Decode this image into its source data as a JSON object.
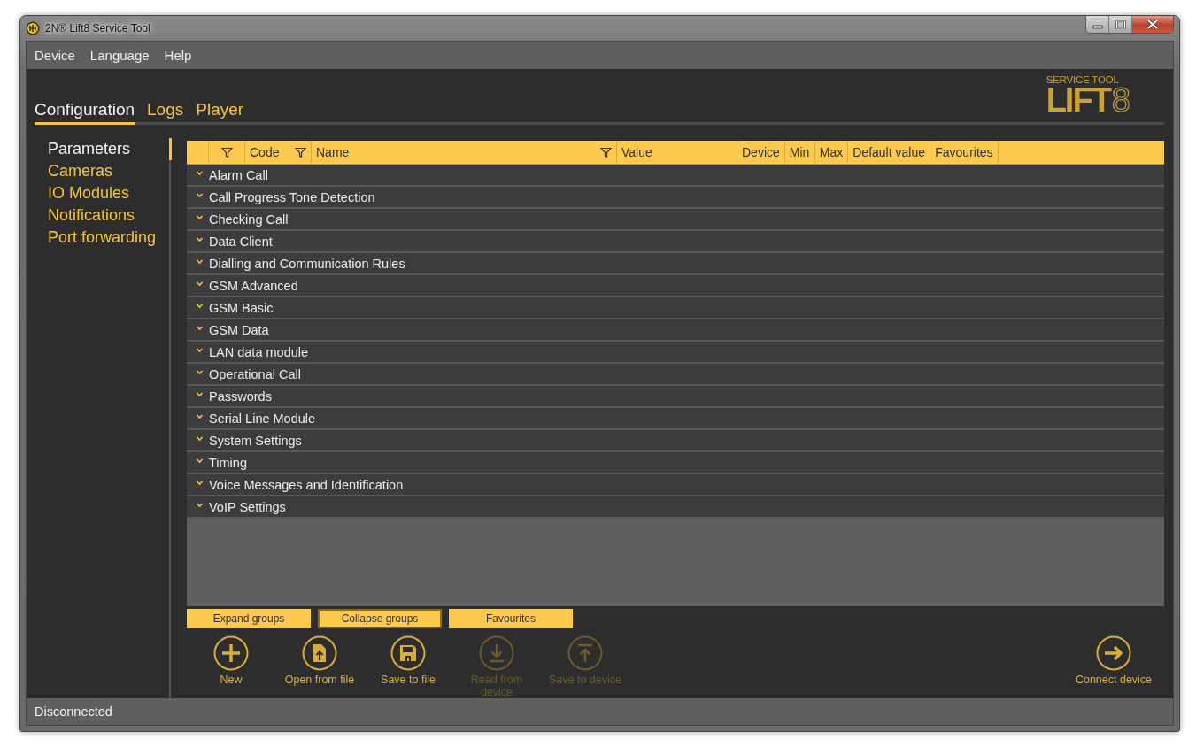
{
  "window": {
    "title": "2N® Lift8 Service Tool"
  },
  "menu": [
    "Device",
    "Language",
    "Help"
  ],
  "tabs": [
    {
      "label": "Configuration",
      "selected": true
    },
    {
      "label": "Logs",
      "selected": false
    },
    {
      "label": "Player",
      "selected": false
    }
  ],
  "logo": {
    "tagline": "SERVICE TOOL",
    "wordmark": "LIFT",
    "numeral": "8"
  },
  "sidebar": {
    "items": [
      {
        "label": "Parameters",
        "selected": true
      },
      {
        "label": "Cameras",
        "selected": false
      },
      {
        "label": "IO Modules",
        "selected": false
      },
      {
        "label": "Notifications",
        "selected": false
      },
      {
        "label": "Port forwarding",
        "selected": false
      }
    ]
  },
  "table": {
    "columns": [
      {
        "filter": false
      },
      {
        "filter": true
      },
      {
        "label": "Code",
        "filter": true
      },
      {
        "label": "Name",
        "filter": true
      },
      {
        "label": "Value",
        "filter": false
      },
      {
        "label": "Device",
        "filter": false
      },
      {
        "label": "Min",
        "filter": false
      },
      {
        "label": "Max",
        "filter": false
      },
      {
        "label": "Default value",
        "filter": false
      },
      {
        "label": "Favourites",
        "filter": false
      }
    ],
    "groups": [
      {
        "name": "Alarm Call",
        "expanded": false
      },
      {
        "name": "Call Progress Tone Detection",
        "expanded": false
      },
      {
        "name": "Checking Call",
        "expanded": false
      },
      {
        "name": "Data Client",
        "expanded": false
      },
      {
        "name": "Dialling and Communication Rules",
        "expanded": false
      },
      {
        "name": "GSM Advanced",
        "expanded": false
      },
      {
        "name": "GSM Basic",
        "expanded": false
      },
      {
        "name": "GSM Data",
        "expanded": false
      },
      {
        "name": "LAN data module",
        "expanded": false
      },
      {
        "name": "Operational Call",
        "expanded": false
      },
      {
        "name": "Passwords",
        "expanded": false
      },
      {
        "name": "Serial Line Module",
        "expanded": false
      },
      {
        "name": "System Settings",
        "expanded": false
      },
      {
        "name": "Timing",
        "expanded": false
      },
      {
        "name": "Voice Messages and Identification",
        "expanded": false
      },
      {
        "name": "VoIP Settings",
        "expanded": false
      }
    ]
  },
  "group_buttons": [
    {
      "label": "Expand groups",
      "focused": false
    },
    {
      "label": "Collapse groups",
      "focused": true
    },
    {
      "label": "Favourites",
      "focused": false
    }
  ],
  "actions": [
    {
      "kind": "new",
      "label": "New",
      "disabled": false
    },
    {
      "kind": "open",
      "label": "Open from file",
      "disabled": false
    },
    {
      "kind": "save",
      "label": "Save to file",
      "disabled": false
    },
    {
      "kind": "read",
      "label": "Read from device",
      "disabled": true
    },
    {
      "kind": "write",
      "label": "Save to device",
      "disabled": true
    }
  ],
  "connect": {
    "label": "Connect device"
  },
  "status_bar": "Disconnected"
}
